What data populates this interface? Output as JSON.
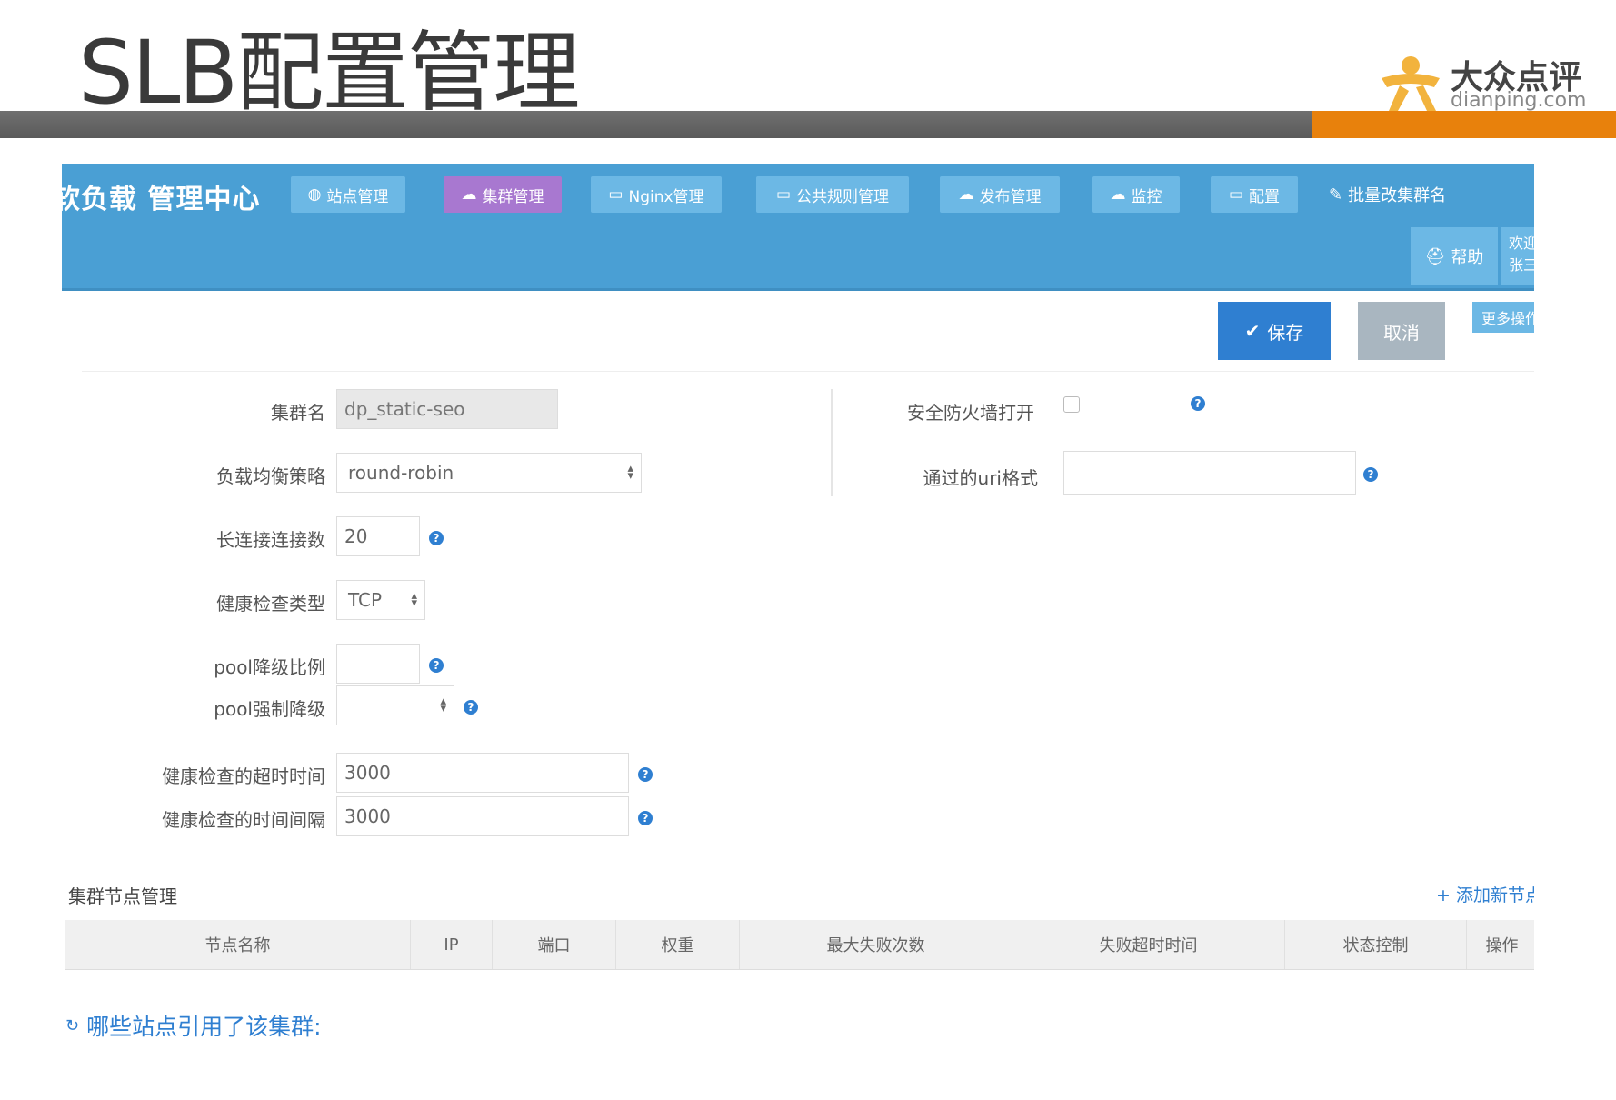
{
  "slide": {
    "title": "SLB配置管理",
    "logo_cn": "大众点评",
    "logo_en": "dianping.com",
    "colors": {
      "gray_bar": "#626262",
      "orange_bar": "#e8810c",
      "logo_orange": "#f2b33d"
    }
  },
  "navbar": {
    "brand": "软负载 管理中心",
    "items": [
      {
        "label": "站点管理",
        "icon": "globe-icon"
      },
      {
        "label": "集群管理",
        "icon": "cloud-icon"
      },
      {
        "label": "Nginx管理",
        "icon": "laptop-icon"
      },
      {
        "label": "公共规则管理",
        "icon": "laptop-icon"
      },
      {
        "label": "发布管理",
        "icon": "cloud-upload-icon"
      },
      {
        "label": "监控",
        "icon": "cloud-upload-icon"
      },
      {
        "label": "配置",
        "icon": "laptop-icon"
      },
      {
        "label": "批量改集群名",
        "icon": "edit-icon"
      }
    ],
    "help": "帮助",
    "welcome": "欢迎 张三",
    "colors": {
      "bar": "#4a9fd4",
      "button": "#6cb8e5",
      "active": "#a878d0"
    }
  },
  "actions": {
    "save": "保存",
    "cancel": "取消",
    "more": "更多操作"
  },
  "form": {
    "cluster_name": {
      "label": "集群名",
      "value": "dp_static-seo"
    },
    "lb_strategy": {
      "label": "负载均衡策略",
      "value": "round-robin"
    },
    "keepalive": {
      "label": "长连接连接数",
      "value": "20"
    },
    "health_type": {
      "label": "健康检查类型",
      "value": "TCP"
    },
    "pool_ratio": {
      "label": "pool降级比例",
      "value": ""
    },
    "pool_force": {
      "label": "pool强制降级",
      "value": ""
    },
    "health_timeout": {
      "label": "健康检查的超时时间",
      "value": "3000"
    },
    "health_interval": {
      "label": "健康检查的时间间隔",
      "value": "3000"
    },
    "firewall": {
      "label": "安全防火墙打开",
      "checked": false
    },
    "uri_format": {
      "label": "通过的uri格式",
      "value": ""
    },
    "help_mark": "?"
  },
  "nodes": {
    "title": "集群节点管理",
    "add": "添加新节点",
    "columns": [
      "节点名称",
      "IP",
      "端口",
      "权重",
      "最大失败次数",
      "失败超时时间",
      "状态控制",
      "操作"
    ]
  },
  "references": {
    "title": "哪些站点引用了该集群:"
  }
}
